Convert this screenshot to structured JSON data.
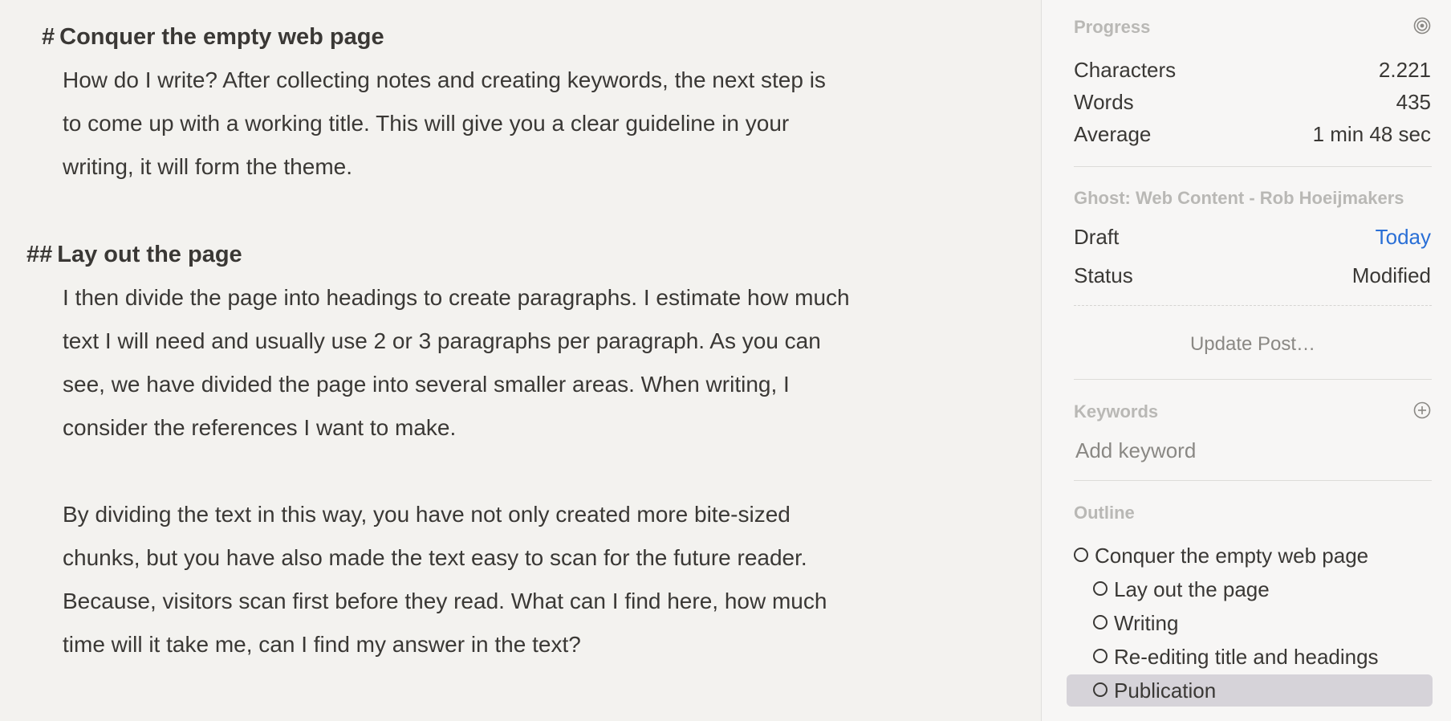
{
  "editor": {
    "h1": {
      "marker": "#",
      "text": "Conquer the empty web page"
    },
    "p1": [
      "How do I write? After collecting notes and creating keywords, the next step is",
      "to come up with a working title. This will give you a clear guideline in your",
      "writing, it will form the theme."
    ],
    "h2": {
      "marker": "##",
      "text": "Lay out the page"
    },
    "p2": [
      "I then divide the page into headings to create paragraphs. I estimate how much",
      "text I will need and usually use 2 or 3 paragraphs per paragraph. As you can",
      "see, we have divided the page into several smaller areas. When writing, I",
      "consider the references I want to make."
    ],
    "p3": [
      "By dividing the text in this way, you have not only created more bite-sized",
      "chunks, but you have also made the text easy to scan for the future reader.",
      "Because, visitors scan first before they read. What can I find here, how much",
      "time will it take me, can I find my answer in the text?"
    ]
  },
  "sidebar": {
    "progress": {
      "label": "Progress",
      "icon": "target-icon",
      "characters_label": "Characters",
      "characters_value": "2.221",
      "words_label": "Words",
      "words_value": "435",
      "average_label": "Average",
      "average_value": "1 min 48 sec"
    },
    "publish": {
      "label": "Ghost: Web Content - Rob Hoeijmakers",
      "draft_label": "Draft",
      "draft_value": "Today",
      "status_label": "Status",
      "status_value": "Modified",
      "update_button": "Update Post…"
    },
    "keywords": {
      "label": "Keywords",
      "icon": "add-circle-icon",
      "placeholder": "Add keyword"
    },
    "outline": {
      "label": "Outline",
      "items": [
        "Conquer the empty web page",
        "Lay out the page",
        "Writing",
        "Re-editing title and headings",
        "Publication"
      ],
      "selected": "Publication"
    }
  },
  "colors": {
    "editor_bg": "#f3f2ef",
    "sidebar_bg": "#f7f6f5",
    "text": "#3a3835",
    "muted_label": "#b9b8b5",
    "link": "#2a6fd6",
    "selection": "#d6d3d9"
  }
}
